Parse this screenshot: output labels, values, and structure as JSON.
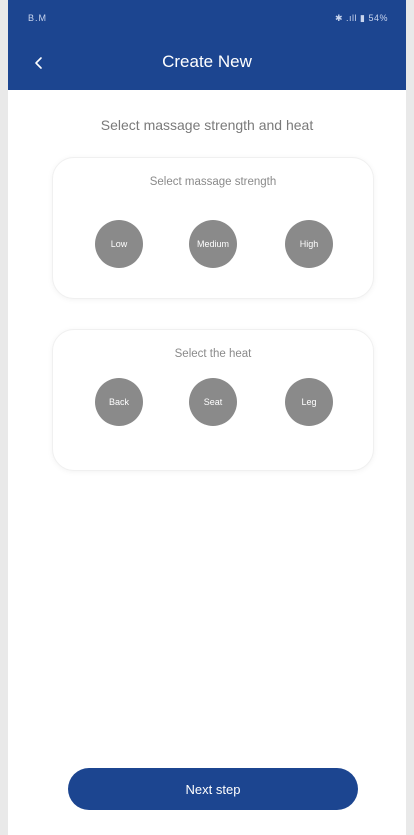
{
  "status_bar": {
    "left": "B.M",
    "right": "✱ .ıll ▮ 54%"
  },
  "header": {
    "title": "Create New",
    "back_icon": "chevron-left-icon"
  },
  "main": {
    "subtitle": "Select massage strength and heat",
    "strength": {
      "label": "Select massage strength",
      "options": [
        "Low",
        "Medium",
        "High"
      ]
    },
    "heat": {
      "label": "Select the heat",
      "options": [
        "Back",
        "Seat",
        "Leg"
      ]
    }
  },
  "footer": {
    "next_label": "Next step"
  },
  "colors": {
    "primary": "#1c4590",
    "option_bg": "#8a8a8a",
    "background": "#ffffff"
  }
}
